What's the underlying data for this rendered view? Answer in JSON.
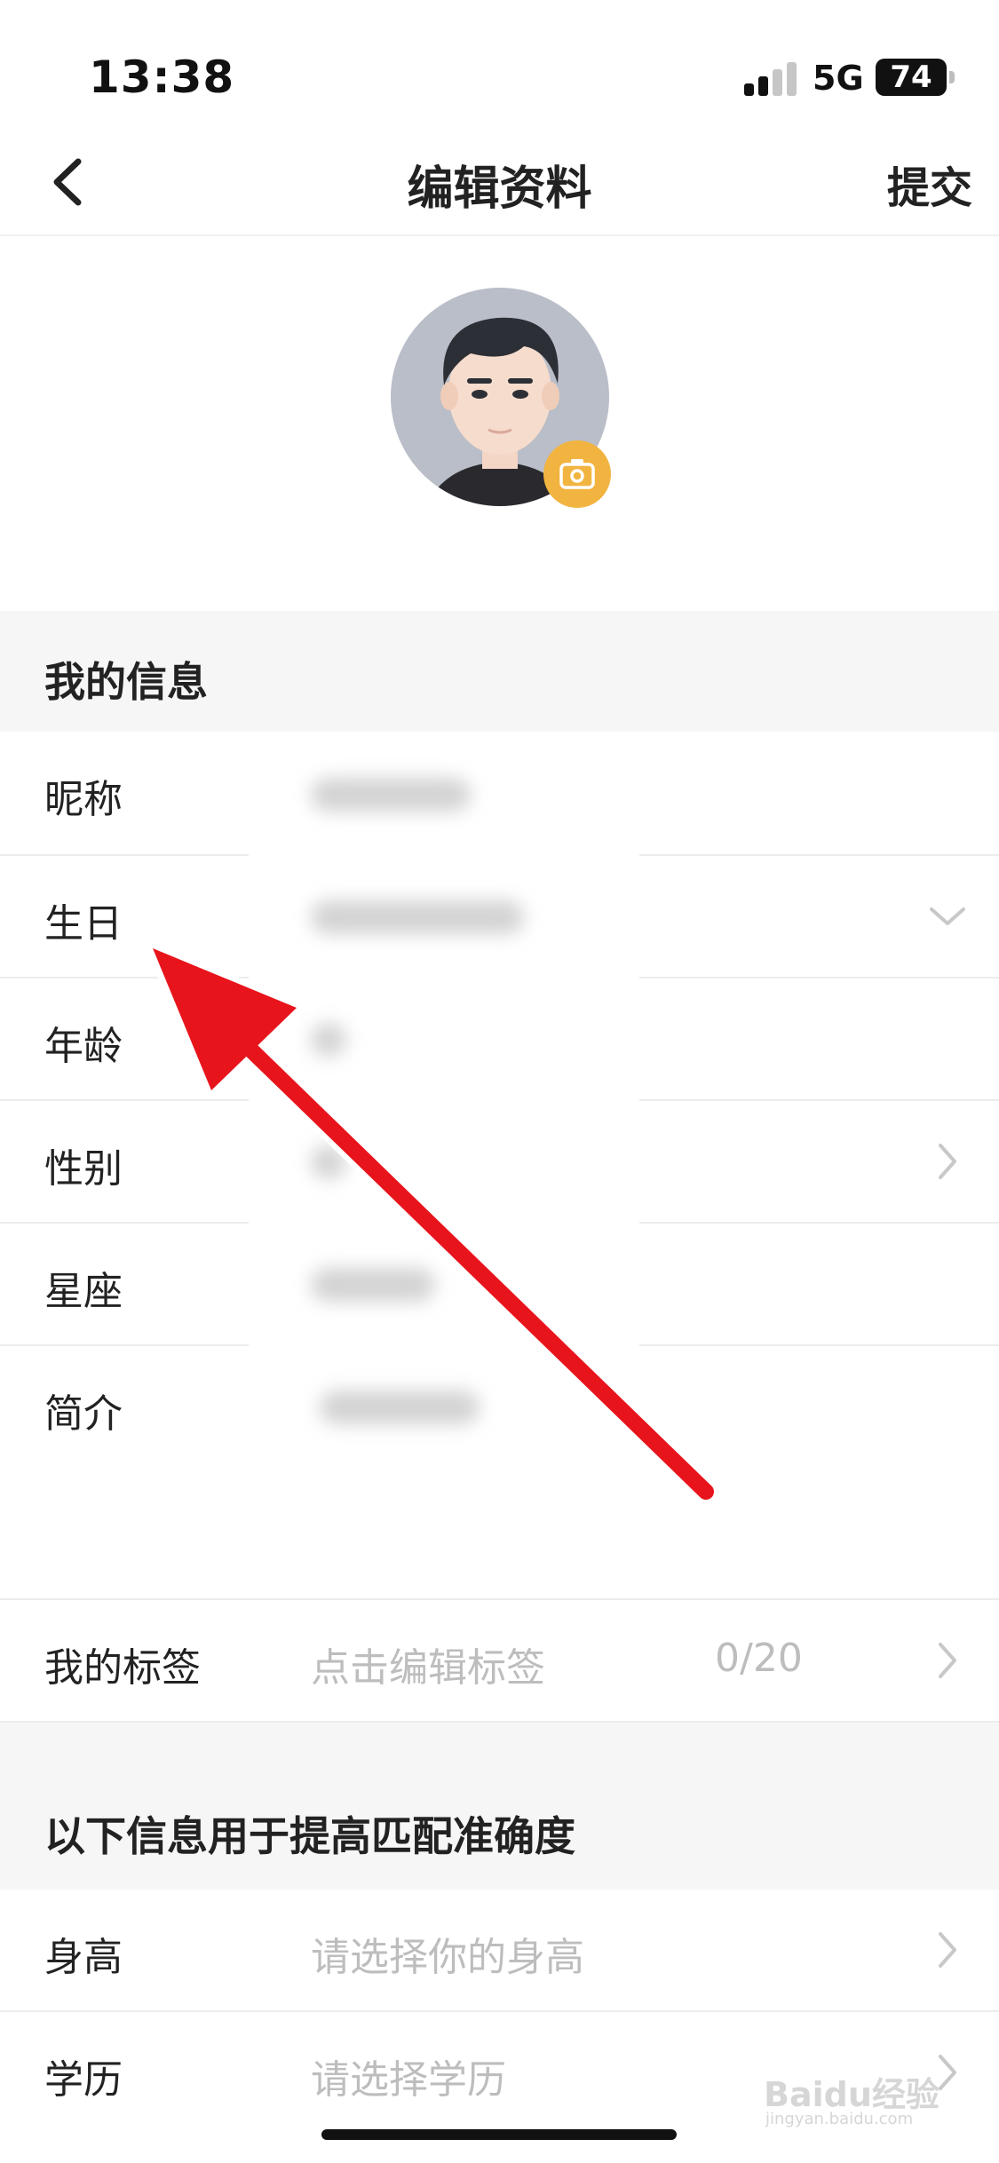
{
  "status_bar": {
    "time": "13:38",
    "network": "5G",
    "battery": "74"
  },
  "nav": {
    "title": "编辑资料",
    "submit": "提交"
  },
  "profile": {
    "avatar_name": "avatar"
  },
  "my_info": {
    "title": "我的信息",
    "rows": [
      {
        "label": "昵称"
      },
      {
        "label": "生日"
      },
      {
        "label": "年龄"
      },
      {
        "label": "性别"
      },
      {
        "label": "星座"
      },
      {
        "label": "简介"
      }
    ]
  },
  "tags": {
    "label": "我的标签",
    "placeholder": "点击编辑标签",
    "count": "0/20"
  },
  "match_info": {
    "title": "以下信息用于提高匹配准确度",
    "rows": [
      {
        "label": "身高",
        "placeholder": "请选择你的身高"
      },
      {
        "label": "学历",
        "placeholder": "请选择学历"
      }
    ]
  },
  "watermark": {
    "text": "Baidu经验",
    "sub": "jingyan.baidu.com"
  },
  "colors": {
    "accent": "#f2b440",
    "arrow": "#e8141c",
    "section_bg": "#f6f6f6"
  }
}
